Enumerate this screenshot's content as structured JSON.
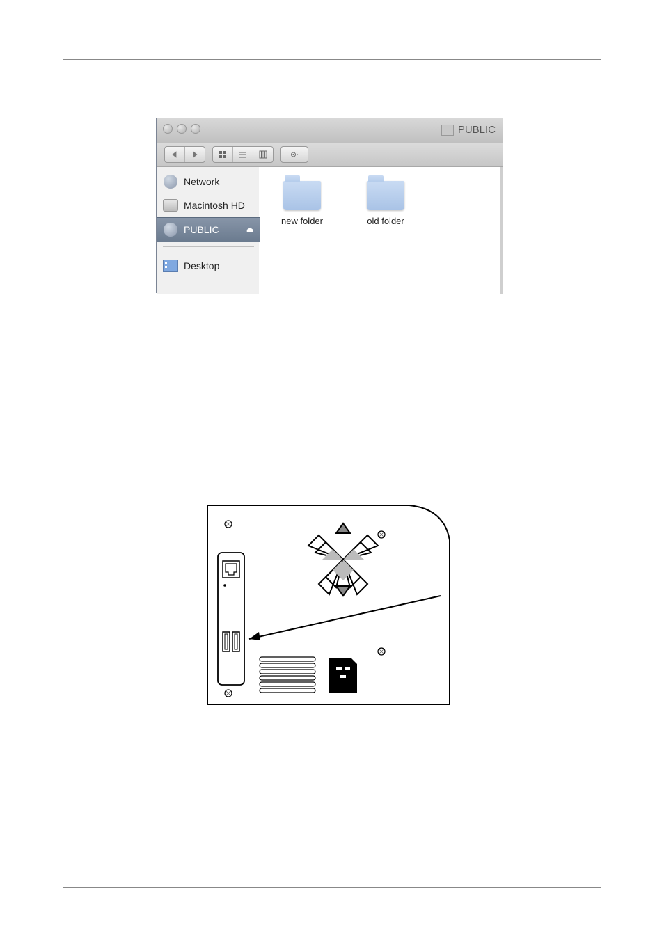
{
  "finder": {
    "title": "PUBLIC",
    "sidebar": {
      "items": [
        {
          "label": "Network"
        },
        {
          "label": "Macintosh HD"
        },
        {
          "label": "PUBLIC"
        },
        {
          "label": "Desktop"
        }
      ]
    },
    "folders": [
      {
        "label": "new folder"
      },
      {
        "label": "old folder"
      }
    ]
  }
}
